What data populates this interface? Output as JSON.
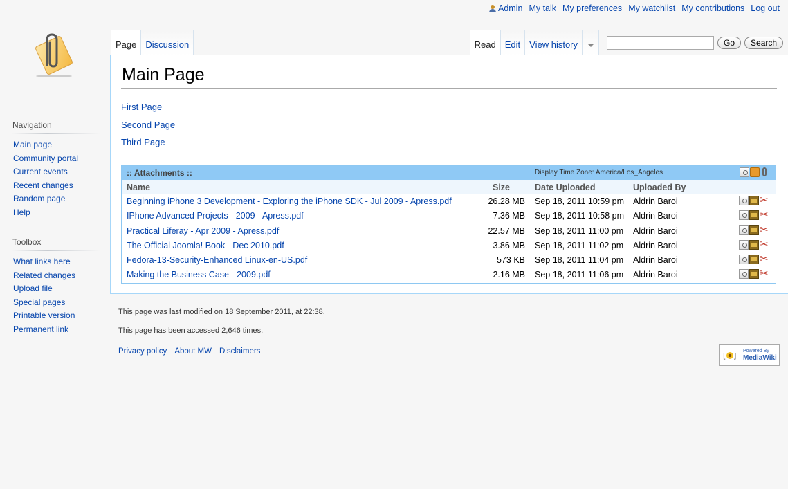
{
  "personal": {
    "user": "Admin",
    "links": [
      "My talk",
      "My preferences",
      "My watchlist",
      "My contributions",
      "Log out"
    ]
  },
  "tabs": {
    "page": "Page",
    "discussion": "Discussion",
    "read": "Read",
    "edit": "Edit",
    "history": "View history"
  },
  "search": {
    "value": "",
    "go_label": "Go",
    "search_label": "Search"
  },
  "sidebar": {
    "navigation": {
      "heading": "Navigation",
      "items": [
        "Main page",
        "Community portal",
        "Current events",
        "Recent changes",
        "Random page",
        "Help"
      ]
    },
    "toolbox": {
      "heading": "Toolbox",
      "items": [
        "What links here",
        "Related changes",
        "Upload file",
        "Special pages",
        "Printable version",
        "Permanent link"
      ]
    }
  },
  "page": {
    "title": "Main Page",
    "links": [
      "First Page",
      "Second Page",
      "Third Page"
    ]
  },
  "attachments": {
    "title": ":: Attachments ::",
    "timezone": "Display Time Zone: America/Los_Angeles",
    "columns": {
      "name": "Name",
      "size": "Size",
      "date": "Date Uploaded",
      "user": "Uploaded By"
    },
    "rows": [
      {
        "name": "Beginning iPhone 3 Development - Exploring the iPhone SDK - Jul 2009 - Apress.pdf",
        "size": "26.28 MB",
        "date": "Sep 18, 2011 10:59 pm",
        "user": "Aldrin Baroi"
      },
      {
        "name": "IPhone Advanced Projects - 2009 - Apress.pdf",
        "size": "7.36 MB",
        "date": "Sep 18, 2011 10:58 pm",
        "user": "Aldrin Baroi"
      },
      {
        "name": "Practical Liferay - Apr 2009 - Apress.pdf",
        "size": "22.57 MB",
        "date": "Sep 18, 2011 11:00 pm",
        "user": "Aldrin Baroi"
      },
      {
        "name": "The Official Joomla! Book - Dec 2010.pdf",
        "size": "3.86 MB",
        "date": "Sep 18, 2011 11:02 pm",
        "user": "Aldrin Baroi"
      },
      {
        "name": "Fedora-13-Security-Enhanced Linux-en-US.pdf",
        "size": "573 KB",
        "date": "Sep 18, 2011 11:04 pm",
        "user": "Aldrin Baroi"
      },
      {
        "name": "Making the Business Case - 2009.pdf",
        "size": "2.16 MB",
        "date": "Sep 18, 2011 11:06 pm",
        "user": "Aldrin Baroi"
      }
    ]
  },
  "footer": {
    "modified": "This page was last modified on 18 September 2011, at 22:38.",
    "accessed": "This page has been accessed 2,646 times.",
    "links": [
      "Privacy policy",
      "About MW",
      "Disclaimers"
    ],
    "badge_line1": "Powered By",
    "badge_line2": "MediaWiki"
  }
}
